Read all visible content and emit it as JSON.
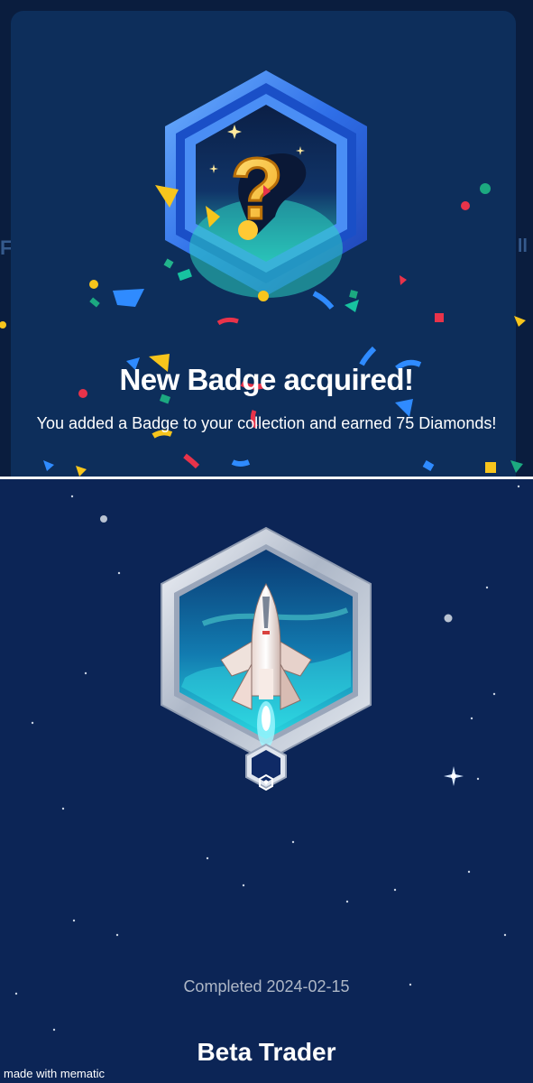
{
  "reward_modal": {
    "title": "New Badge acquired!",
    "message": "You added a Badge to your collection and earned 75 Diamonds!",
    "icon": "mystery-badge-question-mark-icon"
  },
  "background_hint": {
    "left_char": "F",
    "right_char": "ll"
  },
  "badge_detail": {
    "completed_text": "Completed 2024-02-15",
    "badge_name": "Beta Trader",
    "icon": "rocket-badge-icon",
    "emblem_icon": "crypto-com-logo-icon"
  },
  "watermark": "made with mematic",
  "colors": {
    "modal_bg": "#0d2e5b",
    "detail_bg": "#0c2556",
    "badge_blue": "#3a86ff",
    "badge_silver": "#c9d2de"
  }
}
